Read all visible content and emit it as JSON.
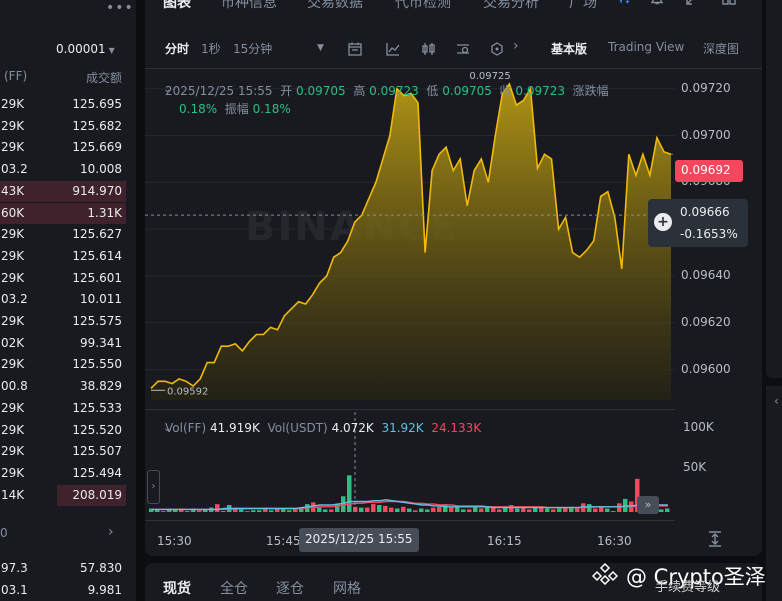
{
  "orderbook": {
    "precision": "0.00001",
    "header_left": "(FF)",
    "header_right": "成交额",
    "rows": [
      {
        "amount": "29K",
        "total": "125.695"
      },
      {
        "amount": "29K",
        "total": "125.682"
      },
      {
        "amount": "29K",
        "total": "125.669"
      },
      {
        "amount": "03.2",
        "total": "10.008"
      },
      {
        "amount": "43K",
        "total": "914.970"
      },
      {
        "amount": "60K",
        "total": "1.31K"
      },
      {
        "amount": "29K",
        "total": "125.627"
      },
      {
        "amount": "29K",
        "total": "125.614"
      },
      {
        "amount": "29K",
        "total": "125.601"
      },
      {
        "amount": "03.2",
        "total": "10.011"
      },
      {
        "amount": "29K",
        "total": "125.575"
      },
      {
        "amount": "02K",
        "total": "99.341"
      },
      {
        "amount": "29K",
        "total": "125.550"
      },
      {
        "amount": "00.8",
        "total": "38.829"
      },
      {
        "amount": "29K",
        "total": "125.533"
      },
      {
        "amount": "29K",
        "total": "125.520"
      },
      {
        "amount": "29K",
        "total": "125.507"
      },
      {
        "amount": "29K",
        "total": "125.494"
      },
      {
        "amount": "14K",
        "total": "208.019"
      }
    ],
    "depth_fractions": [
      0,
      0,
      0,
      0,
      1.0,
      1.0,
      0,
      0,
      0,
      0,
      0,
      0,
      0,
      0,
      0,
      0,
      0,
      0,
      0.55
    ],
    "footer_left": "0",
    "bottom_rows": [
      {
        "amount": "97.3",
        "total": "57.830"
      },
      {
        "amount": "03.1",
        "total": "9.981"
      }
    ]
  },
  "topnav": {
    "tabs": [
      "图表",
      "币种信息",
      "交易数据",
      "代币检测",
      "交易分析",
      "广场"
    ]
  },
  "toolbar": {
    "intervals": [
      "分时",
      "1秒",
      "15分钟"
    ],
    "views": [
      "基本版",
      "Trading View",
      "深度图"
    ]
  },
  "legend": {
    "datetime": "2025/12/25 15:55",
    "open_label": "开",
    "open": "0.09705",
    "high_label": "高",
    "high": "0.09723",
    "low_label": "低",
    "low": "0.09705",
    "close_label": "收",
    "close": "0.09723",
    "change_label": "涨跌幅",
    "change": "0.18%",
    "amplitude_label": "振幅",
    "amplitude": "0.18%"
  },
  "price_axis": {
    "ticks": [
      "0.09720",
      "0.09700",
      "0.09680",
      "0.09660",
      "0.09640",
      "0.09620",
      "0.09600"
    ],
    "current_price": "0.09692",
    "crosshair_price": "0.09666",
    "crosshair_change": "-0.1653%",
    "max_label": "0.09725",
    "min_label": "0.09592"
  },
  "volume_legend": {
    "vol_ff_label": "Vol(FF)",
    "vol_ff": "41.919K",
    "vol_usdt_label": "Vol(USDT)",
    "vol_usdt": "4.072K",
    "ma1": "31.92K",
    "ma2": "24.133K",
    "axis_ticks": [
      "100K",
      "50K"
    ]
  },
  "xaxis": {
    "labels": [
      "15:30",
      "15:45",
      "16:15",
      "16:30"
    ],
    "crosshair_time": "2025/12/25 15:55"
  },
  "watermark": "BINANCE",
  "bottom_tabs": [
    "现货",
    "全仓",
    "逐仓",
    "网格"
  ],
  "overlay": {
    "title": "@ Crypto圣泽",
    "subtitle": "手续费等级"
  },
  "colors": {
    "up": "#2ebd85",
    "down": "#f6465d",
    "line": "#f0b90b",
    "accent_cyan": "#5ec2e6"
  },
  "chart_data": {
    "type": "area",
    "title": "",
    "xlabel": "",
    "ylabel": "",
    "ylim": [
      0.09587,
      0.09728
    ],
    "x_range": [
      "15:24",
      "16:42"
    ],
    "series": [
      {
        "values": [
          0.09592,
          0.09595,
          0.09595,
          0.09594,
          0.09596,
          0.09595,
          0.09593,
          0.09596,
          0.09603,
          0.09603,
          0.0961,
          0.0961,
          0.09611,
          0.09608,
          0.09612,
          0.09615,
          0.09615,
          0.09618,
          0.09617,
          0.09623,
          0.09626,
          0.09629,
          0.09628,
          0.09632,
          0.09637,
          0.0964,
          0.09648,
          0.0965,
          0.09655,
          0.09663,
          0.09666,
          0.09673,
          0.0968,
          0.0969,
          0.097,
          0.0972,
          0.09717,
          0.09718,
          0.09714,
          0.0965,
          0.09685,
          0.09692,
          0.09695,
          0.09685,
          0.0969,
          0.0967,
          0.09685,
          0.0969,
          0.0968,
          0.097,
          0.09718,
          0.09722,
          0.09713,
          0.09715,
          0.0972,
          0.09686,
          0.09692,
          0.0969,
          0.0966,
          0.09665,
          0.0965,
          0.09648,
          0.09651,
          0.09655,
          0.09674,
          0.09676,
          0.09665,
          0.09643,
          0.09692,
          0.09683,
          0.09692,
          0.09683,
          0.09699,
          0.09693,
          0.09692
        ]
      }
    ],
    "volume": {
      "values": [
        4,
        3,
        1,
        4,
        3,
        4,
        1,
        4,
        2,
        3,
        5,
        9,
        1,
        8,
        5,
        3,
        1,
        2,
        2,
        5,
        2,
        4,
        3,
        2,
        3,
        5,
        9,
        11,
        5,
        3,
        3,
        9,
        18,
        42,
        6,
        5,
        5,
        9,
        8,
        7,
        5,
        4,
        6,
        4,
        2,
        4,
        3,
        5,
        6,
        9,
        5,
        6,
        3,
        3,
        5,
        4,
        6,
        5,
        3,
        5,
        8,
        4,
        5,
        3,
        5,
        6,
        4,
        3,
        4,
        5,
        6,
        4,
        10,
        9,
        4,
        6,
        4,
        1,
        10,
        15,
        12,
        38,
        3,
        3,
        2,
        3,
        4
      ],
      "up": [
        1,
        1,
        0,
        1,
        1,
        0,
        1,
        1,
        0,
        1,
        1,
        0,
        1,
        1,
        0,
        1,
        0,
        1,
        1,
        0,
        1,
        0,
        1,
        1,
        0,
        1,
        1,
        0,
        1,
        1,
        0,
        1,
        1,
        1,
        0,
        1,
        0,
        0,
        1,
        0,
        0,
        1,
        0,
        1,
        0,
        1,
        1,
        0,
        0,
        1,
        0,
        1,
        1,
        0,
        1,
        0,
        1,
        0,
        0,
        1,
        0,
        1,
        0,
        0,
        1,
        0,
        1,
        0,
        1,
        0,
        1,
        0,
        0,
        1,
        0,
        0,
        1,
        1,
        0,
        1,
        0,
        0,
        1,
        1,
        1,
        1,
        1
      ],
      "ma1": [
        3,
        3,
        3,
        3,
        3,
        3,
        3,
        3,
        3,
        3,
        3,
        3,
        4,
        4,
        4,
        4,
        4,
        4,
        4,
        4,
        4,
        4,
        4,
        4,
        4,
        5,
        6,
        7,
        8,
        8,
        8,
        9,
        10,
        12,
        12,
        12,
        12,
        13,
        13,
        14,
        13,
        12,
        11,
        10,
        9,
        8,
        8,
        7,
        7,
        6,
        6,
        6,
        6,
        6,
        6,
        6,
        6,
        5,
        5,
        5,
        5,
        5,
        5,
        5,
        5,
        5,
        5,
        5,
        5,
        5,
        5,
        5,
        6,
        6,
        6,
        6,
        6,
        6,
        6,
        7,
        7,
        8,
        8,
        8,
        8,
        8,
        8
      ],
      "ma2": [
        3,
        3,
        3,
        3,
        3,
        3,
        3,
        3,
        3,
        3,
        3,
        3,
        3,
        3,
        4,
        4,
        4,
        4,
        4,
        4,
        4,
        4,
        4,
        4,
        4,
        4,
        5,
        5,
        6,
        6,
        6,
        7,
        8,
        9,
        10,
        10,
        11,
        11,
        11,
        12,
        12,
        12,
        12,
        11,
        10,
        10,
        9,
        9,
        8,
        8,
        8,
        7,
        7,
        7,
        7,
        7,
        6,
        6,
        6,
        6,
        6,
        6,
        6,
        6,
        6,
        6,
        5,
        5,
        5,
        5,
        5,
        5,
        5,
        5,
        6,
        6,
        6,
        6,
        6,
        6,
        6,
        7,
        7,
        7,
        7,
        7,
        7
      ],
      "ylim": [
        0,
        110
      ]
    }
  }
}
